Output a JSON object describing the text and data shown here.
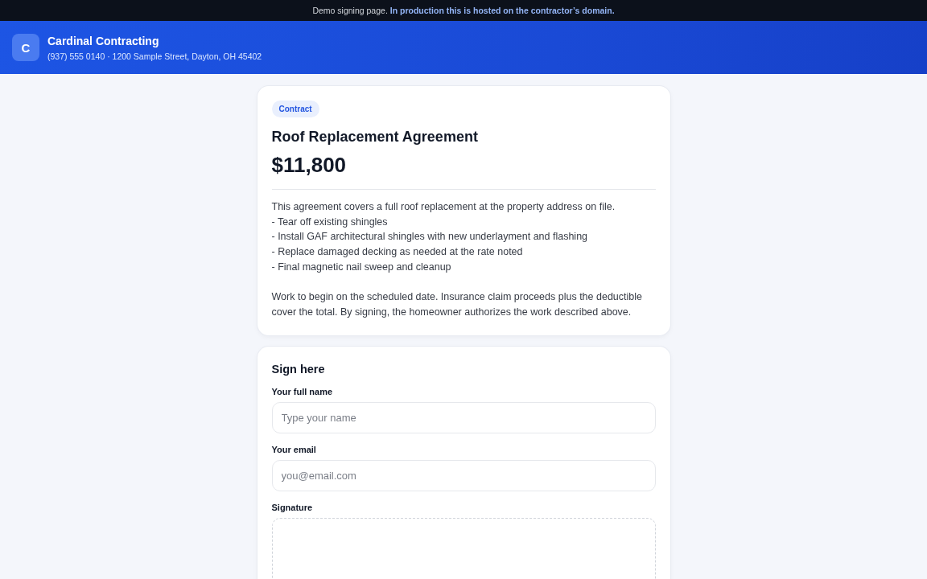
{
  "banner": {
    "text": "Demo signing page. **In production this is hosted on the contractor’s domain.**"
  },
  "header": {
    "logo_letter": "C",
    "company": "Cardinal Contracting",
    "contact": "(937) 555 0140 · 1200 Sample Street, Dayton, OH 45402"
  },
  "document": {
    "badge": "Contract",
    "title": "Roof Replacement Agreement",
    "price": "$11,800",
    "intro": "This agreement covers a full roof replacement at the property address on file.",
    "items": [
      "- Tear off existing shingles",
      "- Install GAF architectural shingles with new underlayment and flashing",
      "- Replace damaged decking as needed at the rate noted",
      "- Final magnetic nail sweep and cleanup"
    ],
    "closing": "Work to begin on the scheduled date. Insurance claim proceeds plus the deductible cover the total. By signing, the homeowner authorizes the work described above."
  },
  "sign_form": {
    "title": "Sign here",
    "fields": [
      {
        "kind": "text",
        "label": "Your full name",
        "placeholder": "Type your name"
      },
      {
        "kind": "text",
        "label": "Your email",
        "placeholder": "you@email.com"
      },
      {
        "kind": "signature",
        "label": "Signature"
      }
    ]
  }
}
